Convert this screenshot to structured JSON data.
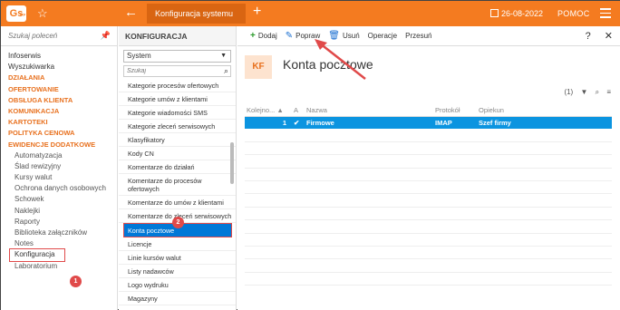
{
  "app": {
    "logo": "Gs",
    "logo_sub": "erp",
    "active_tab": "Konfiguracja systemu",
    "date": "26-08-2022",
    "help_label": "POMOC"
  },
  "left_sidebar": {
    "search_placeholder": "Szukaj poleceń",
    "items": [
      {
        "label": "Infoserwis",
        "type": "item"
      },
      {
        "label": "Wyszukiwarka",
        "type": "item"
      },
      {
        "label": "DZIAŁANIA",
        "type": "cat"
      },
      {
        "label": "OFERTOWANIE",
        "type": "cat"
      },
      {
        "label": "OBSŁUGA KLIENTA",
        "type": "cat"
      },
      {
        "label": "KOMUNIKACJA",
        "type": "cat"
      },
      {
        "label": "KARTOTEKI",
        "type": "cat"
      },
      {
        "label": "POLITYKA CENOWA",
        "type": "cat"
      },
      {
        "label": "EWIDENCJE DODATKOWE",
        "type": "cat"
      },
      {
        "label": "Automatyzacja",
        "type": "sub"
      },
      {
        "label": "Ślad rewizyjny",
        "type": "sub"
      },
      {
        "label": "Kursy walut",
        "type": "sub"
      },
      {
        "label": "Ochrona danych osobowych",
        "type": "sub"
      },
      {
        "label": "Schowek",
        "type": "sub"
      },
      {
        "label": "Naklejki",
        "type": "sub"
      },
      {
        "label": "Raporty",
        "type": "sub"
      },
      {
        "label": "Biblioteka załączników",
        "type": "sub"
      },
      {
        "label": "Notes",
        "type": "sub"
      },
      {
        "label": "Konfiguracja",
        "type": "sel"
      },
      {
        "label": "Laboratorium",
        "type": "sub"
      }
    ],
    "badge": "1"
  },
  "middle": {
    "title": "KONFIGURACJA",
    "select_value": "System",
    "search_placeholder": "Szukaj",
    "items": [
      "Kategorie procesów ofertowych",
      "Kategorie umów z klientami",
      "Kategorie wiadomości SMS",
      "Kategorie zleceń serwisowych",
      "Klasyfikatory",
      "Kody CN",
      "Komentarze do działań",
      "Komentarze do procesów ofertowych",
      "Komentarze do umów z klientami",
      "Komentarze do zleceń serwisowych",
      "Konta pocztowe",
      "Licencje",
      "Linie kursów walut",
      "Listy nadawców",
      "Logo wydruku",
      "Magazyny"
    ],
    "selected_index": 10,
    "badge": "2"
  },
  "toolbar": {
    "add": "Dodaj",
    "edit": "Popraw",
    "delete": "Usuń",
    "operations": "Operacje",
    "move": "Przesuń",
    "help": "?",
    "close": "✕"
  },
  "content": {
    "icon_text": "KF",
    "title": "Konta pocztowe",
    "count": "(1)",
    "columns": [
      "Kolejno...",
      "A",
      "Nazwa",
      "Protokół",
      "Opiekun"
    ],
    "rows": [
      {
        "order": "1",
        "active": "✔",
        "name": "Firmowe",
        "protocol": "IMAP",
        "owner": "Szef firmy"
      }
    ]
  },
  "colors": {
    "brand": "#f47b20",
    "selection": "#0b94e0",
    "marker": "#e04a4a"
  }
}
